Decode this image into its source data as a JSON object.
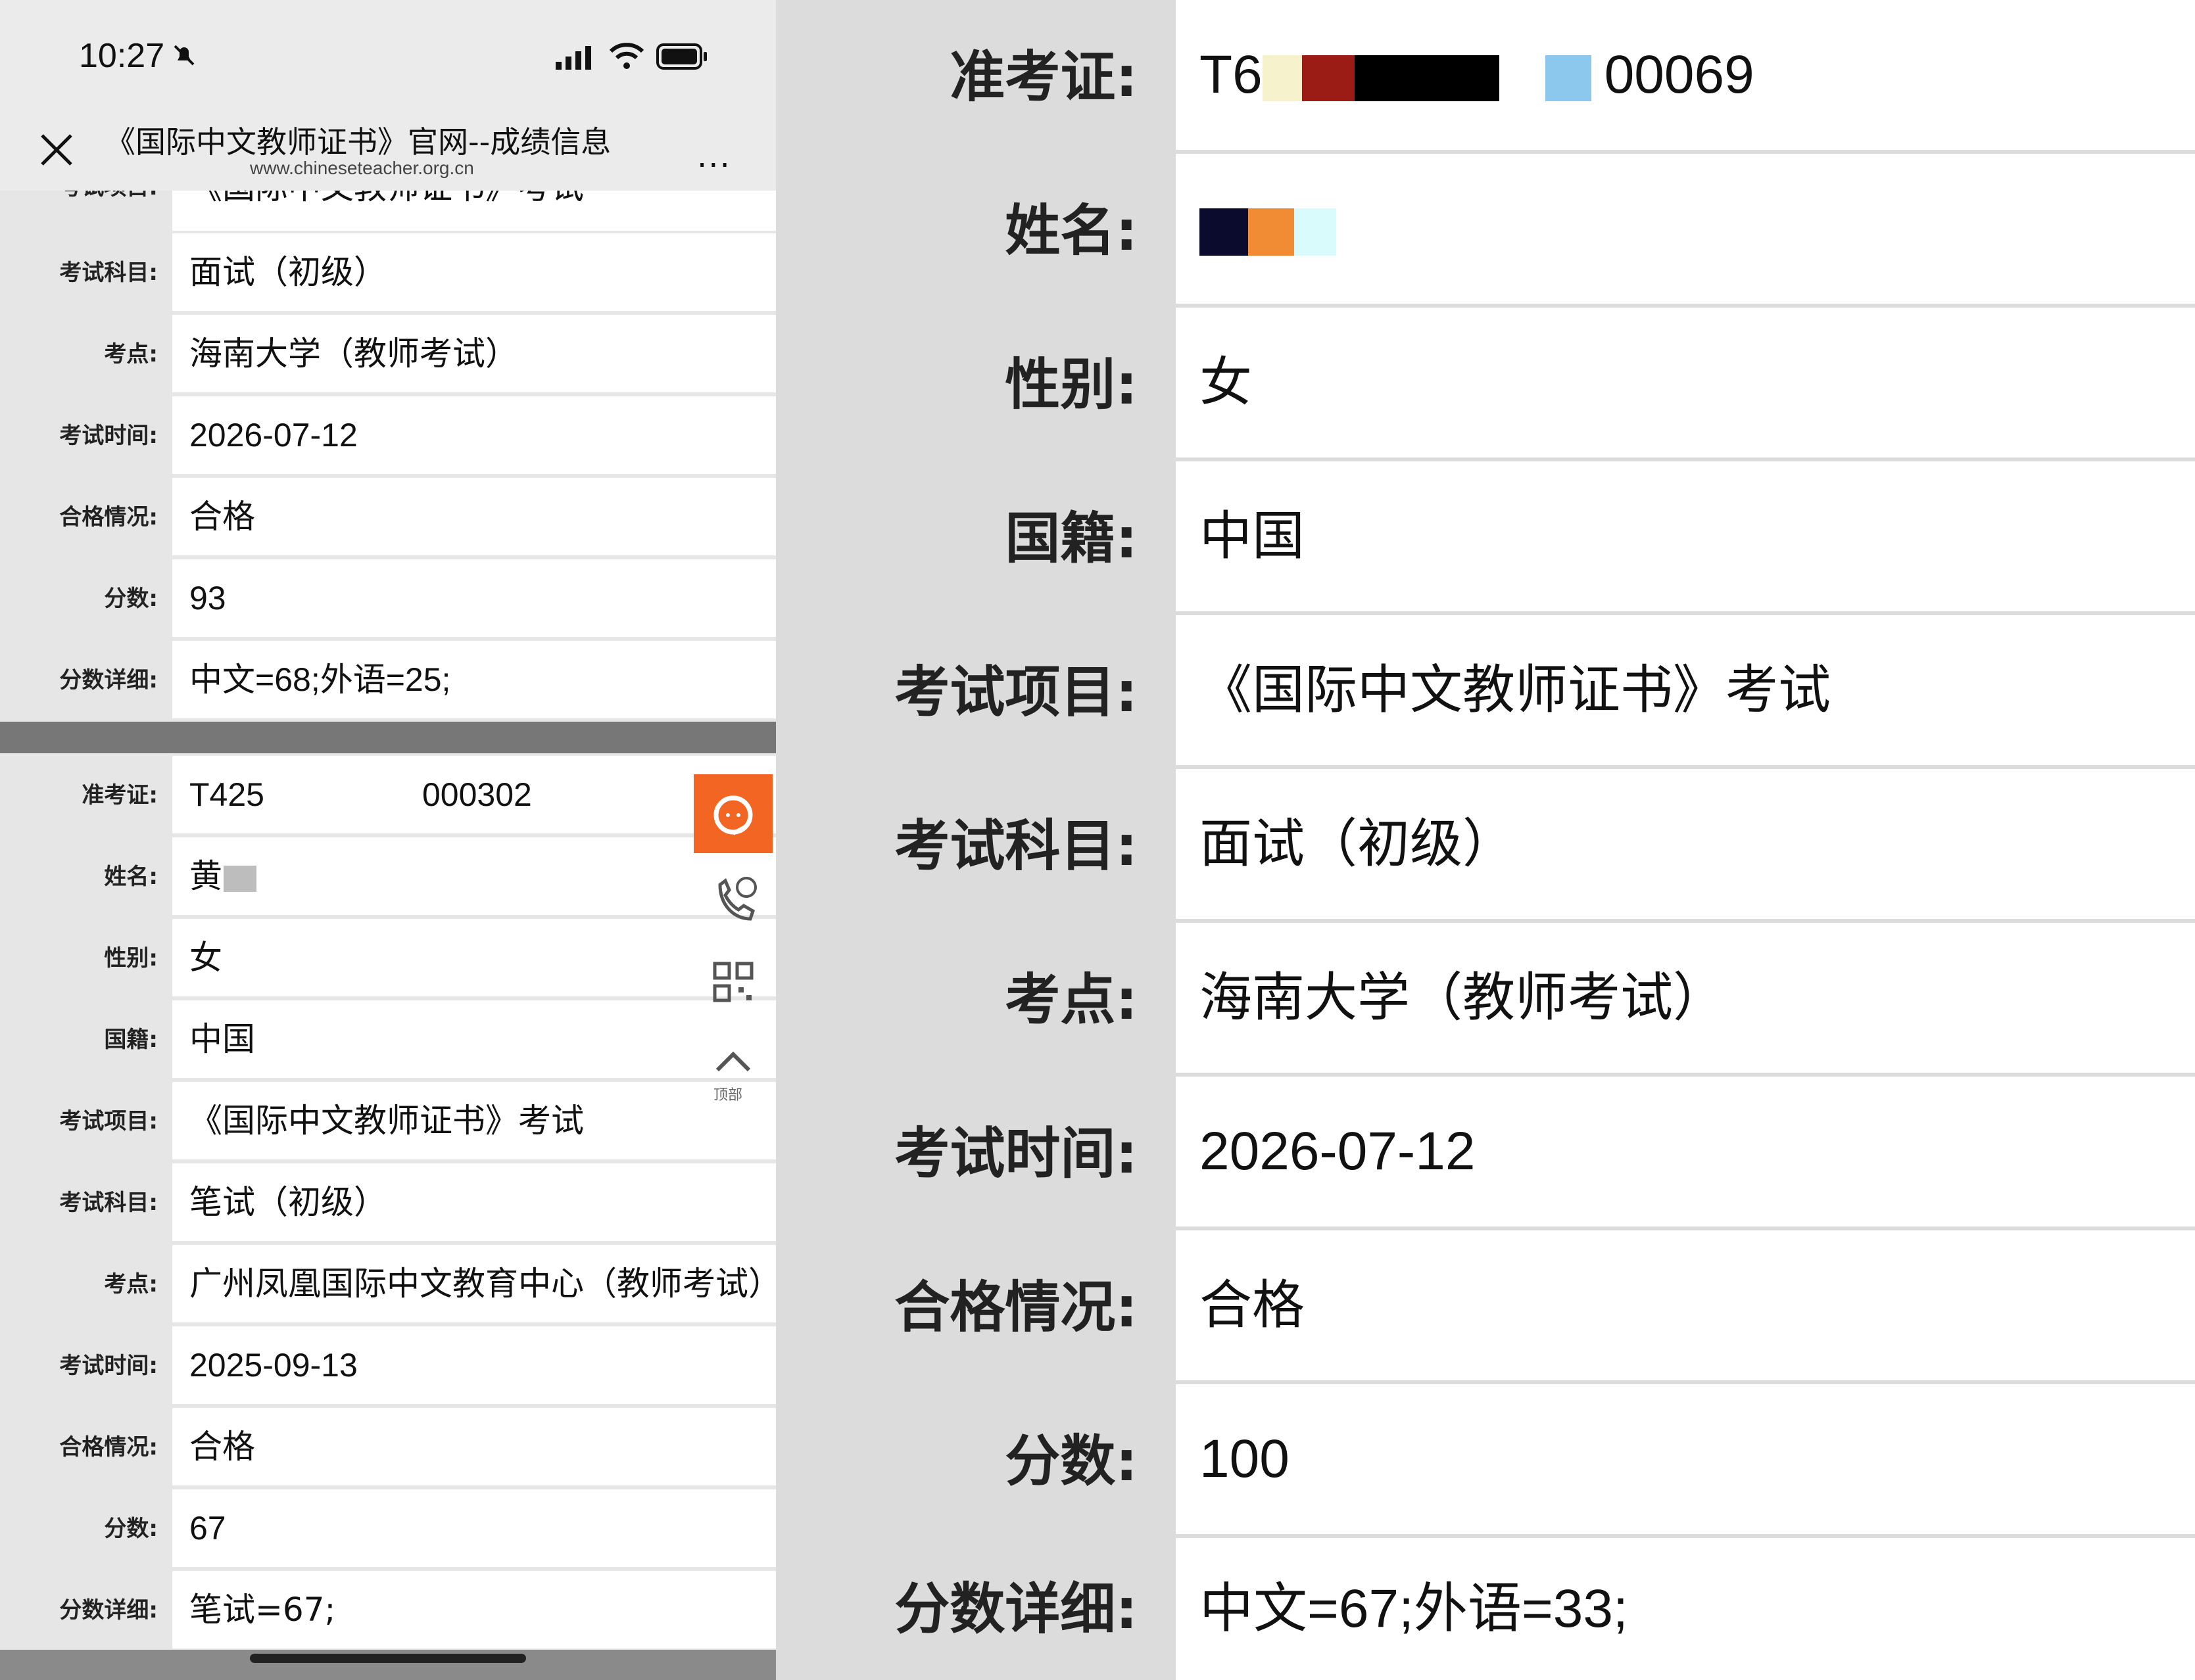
{
  "status_bar": {
    "time": "10:27"
  },
  "nav": {
    "title": "《国际中文教师证书》官网--成绩信息",
    "url": "www.chineseteacher.org.cn",
    "more": "..."
  },
  "record_top": {
    "partial_label": "考试项目:",
    "partial_value": "《国际中文教师证书》考试",
    "rows": [
      {
        "label": "考试科目:",
        "value": "面试（初级）"
      },
      {
        "label": "考点:",
        "value": "海南大学（教师考试）"
      },
      {
        "label": "考试时间:",
        "value": "2026-07-12"
      },
      {
        "label": "合格情况:",
        "value": "合格"
      },
      {
        "label": "分数:",
        "value": "93"
      },
      {
        "label": "分数详细:",
        "value": "中文=68;外语=25;"
      }
    ]
  },
  "record_bottom": {
    "rows": [
      {
        "label": "准考证:",
        "value_prefix": "T425",
        "value_suffix": "000302"
      },
      {
        "label": "姓名:",
        "value": "黄"
      },
      {
        "label": "性别:",
        "value": "女"
      },
      {
        "label": "国籍:",
        "value": "中国"
      },
      {
        "label": "考试项目:",
        "value": "《国际中文教师证书》考试"
      },
      {
        "label": "考试科目:",
        "value": "笔试（初级）"
      },
      {
        "label": "考点:",
        "value": "广州凤凰国际中文教育中心（教师考试）"
      },
      {
        "label": "考试时间:",
        "value": "2025-09-13"
      },
      {
        "label": "合格情况:",
        "value": "合格"
      },
      {
        "label": "分数:",
        "value": "67"
      },
      {
        "label": "分数详细:",
        "value": "笔试=67;"
      }
    ]
  },
  "float_tools": {
    "top_label": "顶部"
  },
  "zoomed": {
    "rows": [
      {
        "label": "准考证:",
        "value_prefix": "T6",
        "value_suffix": "00069"
      },
      {
        "label": "姓名:",
        "value": ""
      },
      {
        "label": "性别:",
        "value": "女"
      },
      {
        "label": "国籍:",
        "value": "中国"
      },
      {
        "label": "考试项目:",
        "value": "《国际中文教师证书》考试"
      },
      {
        "label": "考试科目:",
        "value": "面试（初级）"
      },
      {
        "label": "考点:",
        "value": "海南大学（教师考试）"
      },
      {
        "label": "考试时间:",
        "value": "2026-07-12"
      },
      {
        "label": "合格情况:",
        "value": "合格"
      },
      {
        "label": "分数:",
        "value": "100"
      },
      {
        "label": "分数详细:",
        "value": "中文=67;外语=33;"
      }
    ]
  },
  "colors": {
    "accent_orange": "#f26522",
    "divider": "#777777",
    "field_bg": "#ffffff"
  }
}
